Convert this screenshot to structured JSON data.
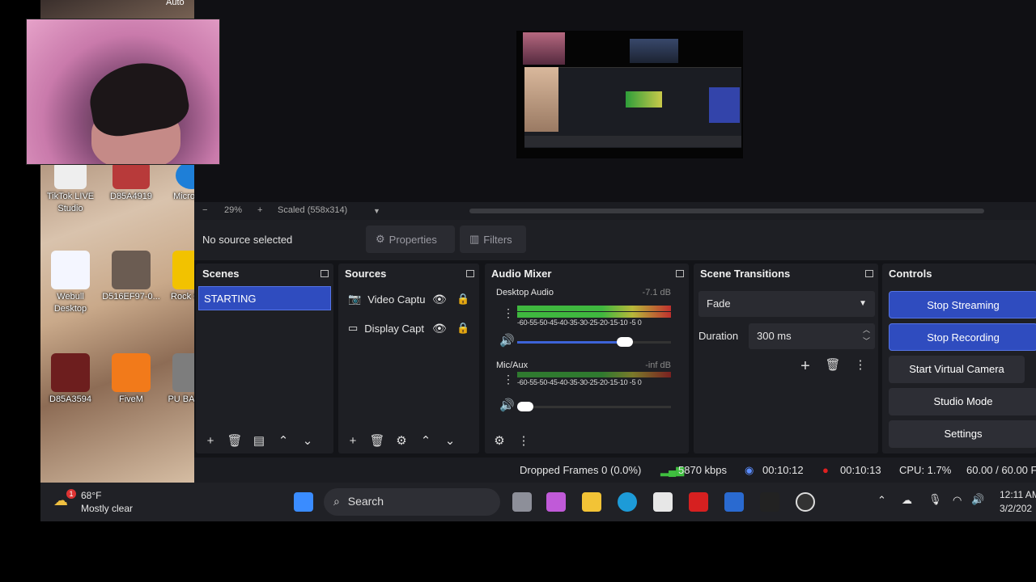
{
  "desktop": {
    "top_label": "Auto",
    "icons": [
      {
        "label": "TikTok LIVE Studio",
        "color": "#e8e8e8"
      },
      {
        "label": "D85A4919",
        "color": "#b83a3a"
      },
      {
        "label": "Micro Edi",
        "color": "#1e7fd8"
      },
      {
        "label": "Webull Desktop",
        "color": "#f4f6ff"
      },
      {
        "label": "D516EF97-0...",
        "color": "#6b5c52"
      },
      {
        "label": "Rock Gam",
        "color": "#f2c200"
      },
      {
        "label": "D85A3594",
        "color": "#6d1e1e"
      },
      {
        "label": "FiveM",
        "color": "#f27a1a"
      },
      {
        "label": "PU BATTLE",
        "color": "#7d7d7d"
      }
    ]
  },
  "zoom": {
    "minus": "−",
    "level": "29%",
    "plus": "+",
    "scaled": "Scaled (558x314)",
    "dropdown": "▼"
  },
  "toolbar": {
    "no_source": "No source selected",
    "properties": "Properties",
    "filters": "Filters"
  },
  "scenes": {
    "title": "Scenes",
    "items": [
      "STARTING"
    ]
  },
  "sources": {
    "title": "Sources",
    "items": [
      {
        "icon": "📷",
        "label": "Video Captu"
      },
      {
        "icon": "▭",
        "label": "Display Capt"
      }
    ]
  },
  "mixer": {
    "title": "Audio Mixer",
    "channels": [
      {
        "name": "Desktop Audio",
        "db": "-7.1 dB",
        "volume": 0.7
      },
      {
        "name": "Mic/Aux",
        "db": "-inf dB",
        "volume": 0.05
      }
    ],
    "ticks": "-60-55-50-45-40-35-30-25-20-15-10 -5  0"
  },
  "transitions": {
    "title": "Scene Transitions",
    "selected": "Fade",
    "duration_label": "Duration",
    "duration_value": "300 ms"
  },
  "controls": {
    "title": "Controls",
    "buttons": [
      "Stop Streaming",
      "Stop Recording",
      "Start Virtual Camera",
      "Studio Mode",
      "Settings"
    ]
  },
  "status": {
    "dropped": "Dropped Frames 0 (0.0%)",
    "bitrate": "5870 kbps",
    "stream_time": "00:10:12",
    "rec_time": "00:10:13",
    "cpu": "CPU: 1.7%",
    "fps": "60.00 / 60.00 F"
  },
  "taskbar": {
    "weather_temp": "68°F",
    "weather_desc": "Mostly clear",
    "weather_badge": "1",
    "search": "Search",
    "time": "12:11 AM",
    "date": "3/2/202"
  }
}
